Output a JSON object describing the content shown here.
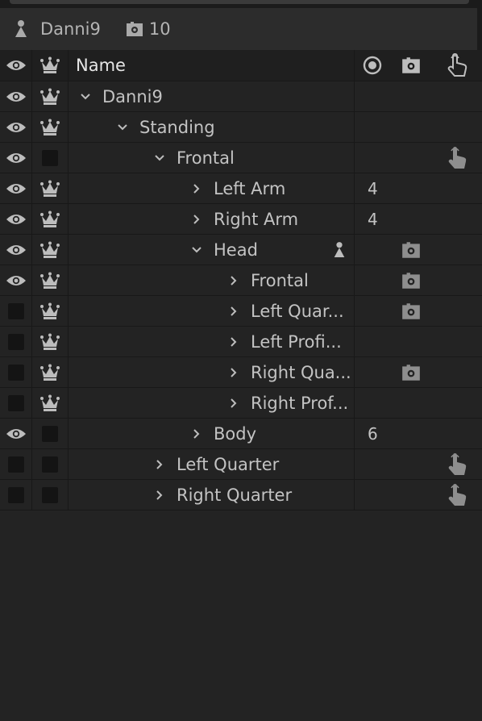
{
  "header": {
    "puppet_name": "Danni9",
    "camera_count": "10"
  },
  "columns": {
    "name": "Name"
  },
  "colors": {
    "background": "#232323",
    "header": "#2c2c2c",
    "icon": "#bdbdbd",
    "text": "#c3c3c3"
  },
  "rows": [
    {
      "name": "Danni9",
      "depth": 0,
      "expanded": true,
      "eye": true,
      "crown": true,
      "number": "",
      "puppet": false,
      "camera": false,
      "trigger": false
    },
    {
      "name": "Standing",
      "depth": 1,
      "expanded": true,
      "eye": true,
      "crown": true,
      "number": "",
      "puppet": false,
      "camera": false,
      "trigger": false
    },
    {
      "name": "Frontal",
      "depth": 2,
      "expanded": true,
      "eye": true,
      "crown": false,
      "number": "",
      "puppet": false,
      "camera": false,
      "trigger": true
    },
    {
      "name": "Left Arm",
      "depth": 3,
      "expanded": false,
      "eye": true,
      "crown": true,
      "number": "4",
      "puppet": false,
      "camera": false,
      "trigger": false
    },
    {
      "name": "Right Arm",
      "depth": 3,
      "expanded": false,
      "eye": true,
      "crown": true,
      "number": "4",
      "puppet": false,
      "camera": false,
      "trigger": false
    },
    {
      "name": "Head",
      "depth": 3,
      "expanded": true,
      "eye": true,
      "crown": true,
      "number": "",
      "puppet": true,
      "camera": true,
      "trigger": false
    },
    {
      "name": "Frontal",
      "depth": 4,
      "expanded": false,
      "eye": true,
      "crown": true,
      "number": "",
      "puppet": false,
      "camera": true,
      "trigger": false
    },
    {
      "name": "Left Quar...",
      "depth": 4,
      "expanded": false,
      "eye": false,
      "crown": true,
      "number": "",
      "puppet": false,
      "camera": true,
      "trigger": false
    },
    {
      "name": "Left Profi...",
      "depth": 4,
      "expanded": false,
      "eye": false,
      "crown": true,
      "number": "",
      "puppet": false,
      "camera": false,
      "trigger": false
    },
    {
      "name": "Right Qua...",
      "depth": 4,
      "expanded": false,
      "eye": false,
      "crown": true,
      "number": "",
      "puppet": false,
      "camera": true,
      "trigger": false
    },
    {
      "name": "Right Prof...",
      "depth": 4,
      "expanded": false,
      "eye": false,
      "crown": true,
      "number": "",
      "puppet": false,
      "camera": false,
      "trigger": false
    },
    {
      "name": "Body",
      "depth": 3,
      "expanded": false,
      "eye": true,
      "crown": false,
      "number": "6",
      "puppet": false,
      "camera": false,
      "trigger": false
    },
    {
      "name": "Left Quarter",
      "depth": 2,
      "expanded": false,
      "eye": false,
      "crown": false,
      "number": "",
      "puppet": false,
      "camera": false,
      "trigger": true
    },
    {
      "name": "Right Quarter",
      "depth": 2,
      "expanded": false,
      "eye": false,
      "crown": false,
      "number": "",
      "puppet": false,
      "camera": false,
      "trigger": true
    }
  ]
}
